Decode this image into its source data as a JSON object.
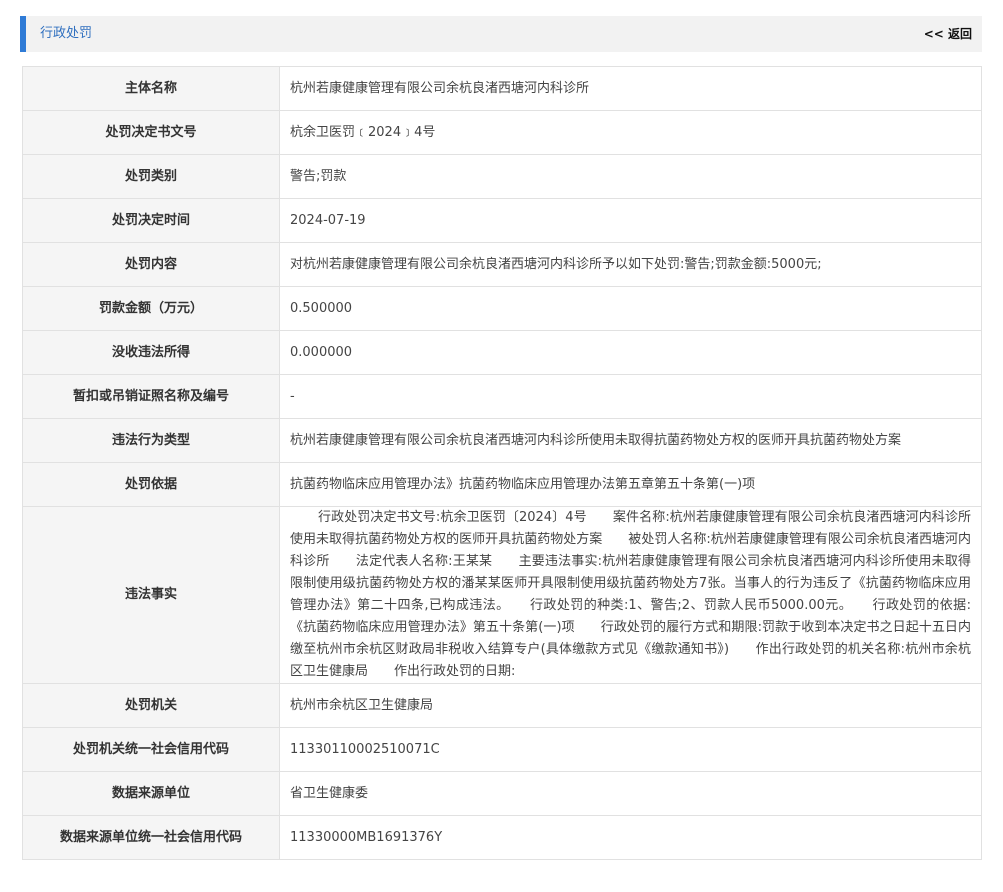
{
  "header": {
    "title": "行政处罚",
    "back_label": "<< 返回"
  },
  "rows": [
    {
      "label": "主体名称",
      "value": "杭州若康健康管理有限公司余杭良渚西塘河内科诊所"
    },
    {
      "label": "处罚决定书文号",
      "value": "杭余卫医罚﹝2024﹞4号"
    },
    {
      "label": "处罚类别",
      "value": "警告;罚款"
    },
    {
      "label": "处罚决定时间",
      "value": "2024-07-19"
    },
    {
      "label": "处罚内容",
      "value": "对杭州若康健康管理有限公司余杭良渚西塘河内科诊所予以如下处罚:警告;罚款金额:5000元;"
    },
    {
      "label": "罚款金额（万元）",
      "value": "0.500000"
    },
    {
      "label": "没收违法所得",
      "value": "0.000000"
    },
    {
      "label": "暂扣或吊销证照名称及编号",
      "value": "-"
    },
    {
      "label": "违法行为类型",
      "value": "杭州若康健康管理有限公司余杭良渚西塘河内科诊所使用未取得抗菌药物处方权的医师开具抗菌药物处方案"
    },
    {
      "label": "处罚依据",
      "value": "抗菌药物临床应用管理办法》抗菌药物临床应用管理办法第五章第五十条第(一)项"
    },
    {
      "label": "违法事实",
      "value": "行政处罚决定书文号:杭余卫医罚〔2024〕4号　　案件名称:杭州若康健康管理有限公司余杭良渚西塘河内科诊所使用未取得抗菌药物处方权的医师开具抗菌药物处方案　　被处罚人名称:杭州若康健康管理有限公司余杭良渚西塘河内科诊所　　法定代表人名称:王某某　　主要违法事实:杭州若康健康管理有限公司余杭良渚西塘河内科诊所使用未取得限制使用级抗菌药物处方权的潘某某医师开具限制使用级抗菌药物处方7张。当事人的行为违反了《抗菌药物临床应用管理办法》第二十四条,已构成违法。　　行政处罚的种类:1、警告;2、罚款人民币5000.00元。　　行政处罚的依据:《抗菌药物临床应用管理办法》第五十条第(一)项　　行政处罚的履行方式和期限:罚款于收到本决定书之日起十五日内缴至杭州市余杭区财政局非税收入结算专户(具体缴款方式见《缴款通知书》)　　作出行政处罚的机关名称:杭州市余杭区卫生健康局　　作出行政处罚的日期:"
    },
    {
      "label": "处罚机关",
      "value": "杭州市余杭区卫生健康局"
    },
    {
      "label": "处罚机关统一社会信用代码",
      "value": "11330110002510071C"
    },
    {
      "label": "数据来源单位",
      "value": "省卫生健康委"
    },
    {
      "label": "数据来源单位统一社会信用代码",
      "value": "11330000MB1691376Y"
    }
  ]
}
